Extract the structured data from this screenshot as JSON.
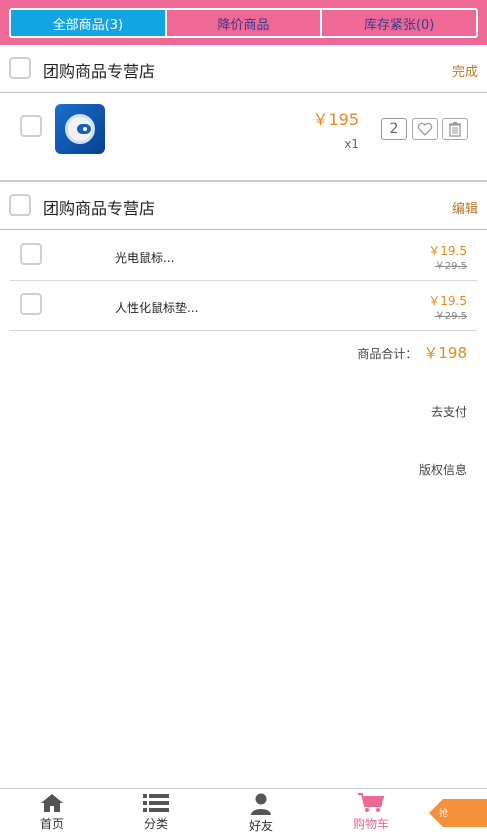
{
  "tabs": [
    {
      "label": "全部商品(3)"
    },
    {
      "label": "降价商品"
    },
    {
      "label": "库存紧张(0)"
    }
  ],
  "shop1": {
    "name": "团购商品专营店",
    "action": "完成",
    "item": {
      "price": "￥195",
      "qty": "x1",
      "quantity": "2"
    }
  },
  "shop2": {
    "name": "团购商品专营店",
    "action": "编辑",
    "items": [
      {
        "name": "光电鼠标...",
        "price": "￥19.5",
        "orig": "￥29.5"
      },
      {
        "name": "人性化鼠标垫...",
        "price": "￥19.5",
        "orig": "￥29.5"
      }
    ]
  },
  "summary": {
    "label": "商品合计：",
    "total": "￥198"
  },
  "pay_label": "去支付",
  "copyright_label": "版权信息",
  "nav": [
    {
      "label": "首页",
      "icon": "home-icon"
    },
    {
      "label": "分类",
      "icon": "list-icon"
    },
    {
      "label": "好友",
      "icon": "user-icon"
    },
    {
      "label": "购物车",
      "icon": "cart-icon"
    }
  ],
  "grab_label": "抢",
  "colors": {
    "accent_pink": "#ee6996",
    "active_blue": "#13a4e4",
    "price_orange": "#e8891c"
  }
}
